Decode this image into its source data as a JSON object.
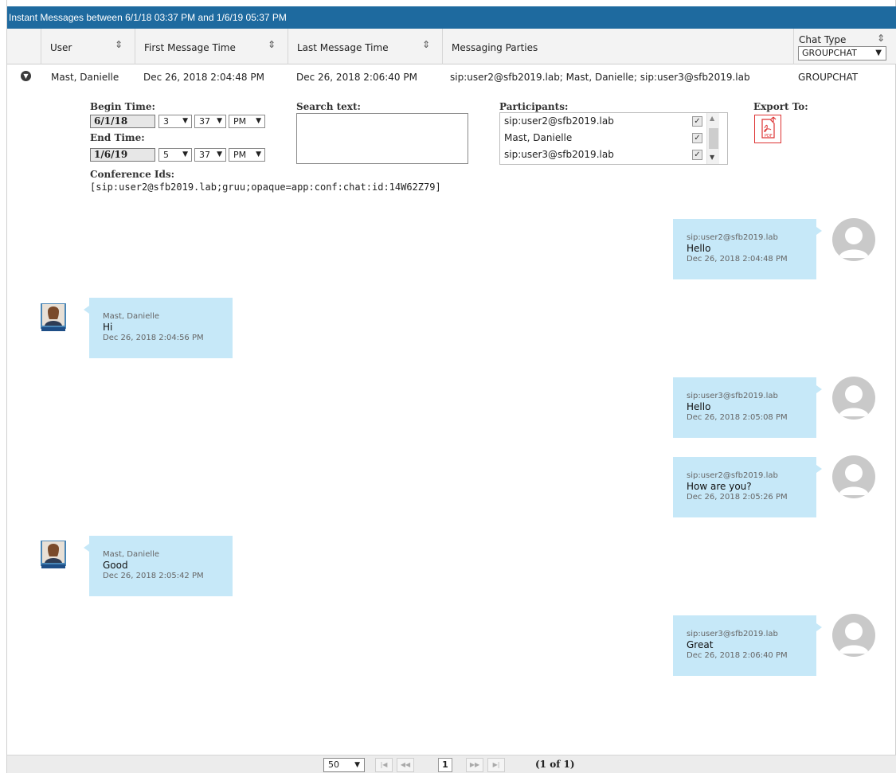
{
  "title": "Instant Messages between 6/1/18 03:37 PM and 1/6/19 05:37 PM",
  "columns": {
    "user": "User",
    "first_time": "First Message Time",
    "last_time": "Last Message Time",
    "parties": "Messaging Parties",
    "chat_type": "Chat Type",
    "chat_type_filter": "GROUPCHAT",
    "sort_icon": "sort-updown-icon"
  },
  "row": {
    "user": "Mast, Danielle",
    "first_time": "Dec 26, 2018 2:04:48 PM",
    "last_time": "Dec 26, 2018 2:06:40 PM",
    "parties": "sip:user2@sfb2019.lab; Mast, Danielle; sip:user3@sfb2019.lab",
    "chat_type": "GROUPCHAT"
  },
  "details": {
    "begin_label": "Begin Time:",
    "begin_date": "6/1/18",
    "begin_hour": "3",
    "begin_minute": "37",
    "begin_ampm": "PM",
    "end_label": "End Time:",
    "end_date": "1/6/19",
    "end_hour": "5",
    "end_minute": "37",
    "end_ampm": "PM",
    "search_label": "Search text:",
    "search_value": "",
    "participants_label": "Participants:",
    "participants": [
      {
        "name": "sip:user2@sfb2019.lab",
        "checked": true
      },
      {
        "name": "Mast, Danielle",
        "checked": true
      },
      {
        "name": "sip:user3@sfb2019.lab",
        "checked": true
      }
    ],
    "export_label": "Export To:",
    "export_icon": "pdf-icon",
    "conference_label": "Conference Ids:",
    "conference_value": "[sip:user2@sfb2019.lab;gruu;opaque=app:conf:chat:id:14W62Z79]"
  },
  "messages": [
    {
      "from": "sip:user2@sfb2019.lab",
      "text": "Hello",
      "time": "Dec 26, 2018 2:04:48 PM",
      "side": "right"
    },
    {
      "from": "Mast, Danielle",
      "text": "Hi",
      "time": "Dec 26, 2018 2:04:56 PM",
      "side": "left"
    },
    {
      "from": "sip:user3@sfb2019.lab",
      "text": "Hello",
      "time": "Dec 26, 2018 2:05:08 PM",
      "side": "right"
    },
    {
      "from": "sip:user2@sfb2019.lab",
      "text": "How are you?",
      "time": "Dec 26, 2018 2:05:26 PM",
      "side": "right"
    },
    {
      "from": "Mast, Danielle",
      "text": "Good",
      "time": "Dec 26, 2018 2:05:42 PM",
      "side": "left"
    },
    {
      "from": "sip:user3@sfb2019.lab",
      "text": "Great",
      "time": "Dec 26, 2018 2:06:40 PM",
      "side": "right"
    }
  ],
  "pager": {
    "page_size": "50",
    "current_page": "1",
    "info": "(1 of 1)",
    "first_icon": "first-page-icon",
    "prev_icon": "prev-page-icon",
    "next_icon": "next-page-icon",
    "last_icon": "last-page-icon"
  }
}
